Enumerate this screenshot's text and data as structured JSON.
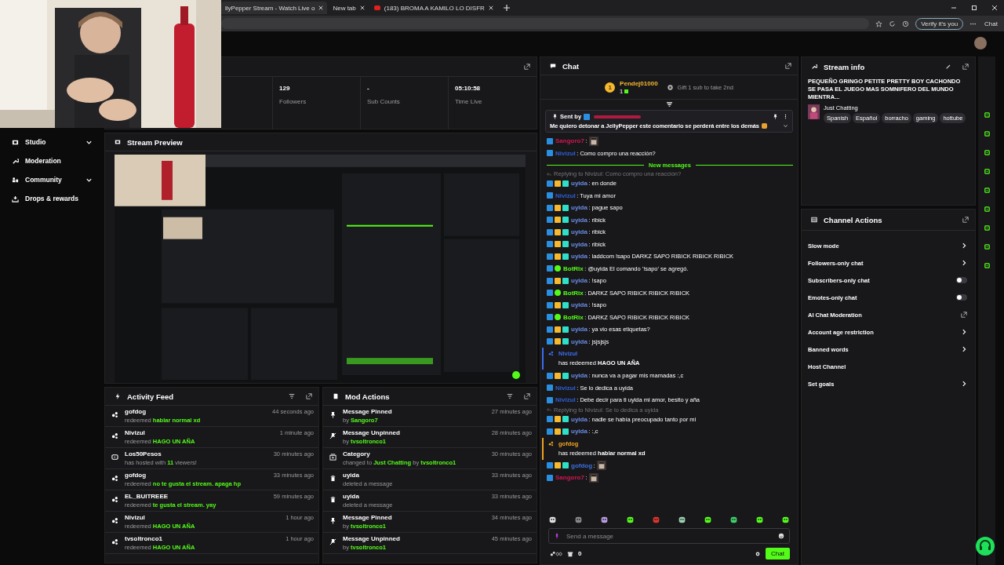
{
  "browser": {
    "tabs": [
      {
        "title": "llyPepper Stream - Watch Live o",
        "selected": true
      },
      {
        "title": "New tab",
        "selected": false
      },
      {
        "title": "(183) BROMA A KAMILO LO DISFR",
        "selected": false
      }
    ],
    "verify_button": "Verify it's you",
    "chat_button": "Chat"
  },
  "sidebar": {
    "items": [
      {
        "label": "Studio",
        "has_submenu": true
      },
      {
        "label": "Moderation",
        "has_submenu": false
      },
      {
        "label": "Community",
        "has_submenu": true
      },
      {
        "label": "Drops & rewards",
        "has_submenu": false
      }
    ]
  },
  "stats": [
    {
      "value": "129",
      "label": "Followers"
    },
    {
      "value": "-",
      "label": "Sub Counts"
    },
    {
      "value": "05:10:58",
      "label": "Time Live"
    }
  ],
  "stream_preview": {
    "title": "Stream Preview",
    "kind": "picture"
  },
  "activity_feed": {
    "title": "Activity Feed",
    "items": [
      {
        "kind": "redeem",
        "user": "gofdog",
        "text": "redeemed **hablar normal xd**",
        "time": "44 seconds ago"
      },
      {
        "kind": "redeem",
        "user": "Nivizul",
        "text": "redeemed **HAGO UN AÑA**",
        "time": "1 minute ago"
      },
      {
        "kind": "host",
        "user": "Los50Pesos",
        "text": "has hosted with **11** viewers!",
        "time": "30 minutes ago"
      },
      {
        "kind": "redeem",
        "user": "gofdog",
        "text": "redeemed **no te gusta el stream. apaga hp**",
        "time": "33 minutes ago"
      },
      {
        "kind": "redeem",
        "user": "EL_BUITREEE",
        "text": "redeemed **te gusta el stream. yay**",
        "time": "59 minutes ago"
      },
      {
        "kind": "redeem",
        "user": "Nivizul",
        "text": "redeemed **HAGO UN AÑA**",
        "time": "1 hour ago"
      },
      {
        "kind": "redeem",
        "user": "tvsoltronco1",
        "text": "redeemed **HAGO UN AÑA**",
        "time": "1 hour ago"
      }
    ]
  },
  "mod_actions": {
    "title": "Mod Actions",
    "items": [
      {
        "kind": "pin",
        "title": "Message Pinned",
        "text": "by **Sangoro7**",
        "time": "27 minutes ago"
      },
      {
        "kind": "unpin",
        "title": "Message Unpinned",
        "text": "by **tvsoltronco1**",
        "time": "28 minutes ago"
      },
      {
        "kind": "category",
        "title": "Category",
        "text": "changed to **Just Chatting** by **tvsoltronco1**",
        "time": "30 minutes ago"
      },
      {
        "kind": "delete",
        "title": "uyida",
        "text": "deleted a message",
        "time": "33 minutes ago"
      },
      {
        "kind": "delete",
        "title": "uyida",
        "text": "deleted a message",
        "time": "33 minutes ago"
      },
      {
        "kind": "pin",
        "title": "Message Pinned",
        "text": "by **tvsoltronco1**",
        "time": "34 minutes ago"
      },
      {
        "kind": "unpin",
        "title": "Message Unpinned",
        "text": "by **tvsoltronco1**",
        "time": "45 minutes ago"
      }
    ]
  },
  "chat": {
    "title": "Chat",
    "leader": {
      "rank": "1",
      "name": "Pendej01000",
      "count": "1",
      "gift": "Gift 1 sub to take 2nd"
    },
    "pinned": {
      "label": "Sent by",
      "text": "Me quiero detonar a JellyPepper este comentario se perderá entre los demás"
    },
    "messages": [
      {
        "kind": "emote",
        "user": "Sangoro7",
        "color": "#d0174f",
        "mod": true,
        "text": ":"
      },
      {
        "kind": "msg",
        "user": "Nivizul",
        "color": "#2f5fd6",
        "mod": true,
        "text": ": Como compro una reacción?"
      },
      {
        "kind": "divider",
        "text": "New messages"
      },
      {
        "kind": "msg",
        "user": "uyida",
        "color": "#6b8ee8",
        "mod": true,
        "crown": true,
        "sub": true,
        "text": ": en donde",
        "reply": "Replying to Nivizul: Como compro una reacción?"
      },
      {
        "kind": "msg",
        "user": "Nivizul",
        "color": "#2f5fd6",
        "mod": true,
        "text": ": Tuya mi amor"
      },
      {
        "kind": "msg",
        "user": "uyida",
        "color": "#6b8ee8",
        "mod": true,
        "crown": true,
        "sub": true,
        "text": ": pague sapo"
      },
      {
        "kind": "msg",
        "user": "uyida",
        "color": "#6b8ee8",
        "mod": true,
        "crown": true,
        "sub": true,
        "text": ": ribick"
      },
      {
        "kind": "msg",
        "user": "uyida",
        "color": "#6b8ee8",
        "mod": true,
        "crown": true,
        "sub": true,
        "text": ": ribick"
      },
      {
        "kind": "msg",
        "user": "uyida",
        "color": "#6b8ee8",
        "mod": true,
        "crown": true,
        "sub": true,
        "text": ": ribick"
      },
      {
        "kind": "msg",
        "user": "uyida",
        "color": "#6b8ee8",
        "mod": true,
        "crown": true,
        "sub": true,
        "text": ": laddcom !sapo DARKZ SAPO RIBICK RIBICK RIBICK"
      },
      {
        "kind": "msg",
        "user": "BotRix",
        "color": "#53fc18",
        "mod": true,
        "verified": true,
        "text": ": @uyida El comando '!sapo' se agregó."
      },
      {
        "kind": "msg",
        "user": "uyida",
        "color": "#6b8ee8",
        "mod": true,
        "crown": true,
        "sub": true,
        "text": ": !sapo"
      },
      {
        "kind": "msg",
        "user": "BotRix",
        "color": "#53fc18",
        "mod": true,
        "verified": true,
        "text": ": DARKZ SAPO RIBICK RIBICK RIBICK"
      },
      {
        "kind": "msg",
        "user": "uyida",
        "color": "#6b8ee8",
        "mod": true,
        "crown": true,
        "sub": true,
        "text": ": !sapo"
      },
      {
        "kind": "msg",
        "user": "BotRix",
        "color": "#53fc18",
        "mod": true,
        "verified": true,
        "text": ": DARKZ SAPO RIBICK RIBICK RIBICK"
      },
      {
        "kind": "msg",
        "user": "uyida",
        "color": "#6b8ee8",
        "mod": true,
        "crown": true,
        "sub": true,
        "text": ": ya vio esas etiquetas?"
      },
      {
        "kind": "msg",
        "user": "uyida",
        "color": "#6b8ee8",
        "mod": true,
        "crown": true,
        "sub": true,
        "text": ": jsjsjsjs"
      },
      {
        "kind": "redeem",
        "user": "Nivizul",
        "color": "#3b6ef0",
        "text": "has redeemed **HAGO UN AÑA**"
      },
      {
        "kind": "msg",
        "user": "uyida",
        "color": "#6b8ee8",
        "mod": true,
        "crown": true,
        "sub": true,
        "text": ": nunca va a pagar mis mamadas :,c"
      },
      {
        "kind": "msg",
        "user": "Nivizul",
        "color": "#2f5fd6",
        "mod": true,
        "text": ": Se lo dedica a uyida"
      },
      {
        "kind": "msg",
        "user": "Nivizul",
        "color": "#2f5fd6",
        "mod": true,
        "text": ": Debe decir para ti uyida mi amor, besito y aña"
      },
      {
        "kind": "msg",
        "user": "uyida",
        "color": "#6b8ee8",
        "mod": true,
        "crown": true,
        "sub": true,
        "text": ": nadie se había preocupado tanto por mi",
        "reply": "Replying to Nivizul: Se lo dedica a uyida"
      },
      {
        "kind": "msg",
        "user": "uyida",
        "color": "#6b8ee8",
        "mod": true,
        "crown": true,
        "sub": true,
        "text": ": :,c"
      },
      {
        "kind": "redeem",
        "user": "gofdog",
        "color": "#f0a21e",
        "text": "has redeemed **hablar normal xd**"
      },
      {
        "kind": "emote",
        "user": "gofdog",
        "color": "#3d6fe0",
        "mod": true,
        "crown": true,
        "sub": true,
        "text": ":"
      },
      {
        "kind": "emote",
        "user": "Sangoro7",
        "color": "#d0174f",
        "mod": true,
        "text": ":"
      }
    ],
    "input": {
      "placeholder": "Send a message"
    },
    "points": "0",
    "send_button": "Chat"
  },
  "stream_info": {
    "title": "Stream info",
    "stream_title": "PEQUEÑO GRINGO PETITE PRETTY BOY CACHONDO SE PASA EL JUEGO MAS SOMNIFERO DEL MUNDO MIENTRA...",
    "category": "Just Chatting",
    "tags": [
      "Spanish",
      "Español",
      "borracho",
      "gaming",
      "hottube"
    ]
  },
  "channel_actions": {
    "title": "Channel Actions",
    "items": [
      {
        "kind": "arrow",
        "label": "Slow mode"
      },
      {
        "kind": "arrow",
        "label": "Followers-only chat"
      },
      {
        "kind": "toggle",
        "label": "Subscribers-only chat",
        "on": false
      },
      {
        "kind": "toggle",
        "label": "Emotes-only chat",
        "on": false
      },
      {
        "kind": "external",
        "label": "AI Chat Moderation"
      },
      {
        "kind": "arrow",
        "label": "Account age restriction"
      },
      {
        "kind": "arrow",
        "label": "Banned words"
      },
      {
        "kind": "plain",
        "label": "Host Channel"
      },
      {
        "kind": "arrow",
        "label": "Set goals"
      }
    ]
  }
}
